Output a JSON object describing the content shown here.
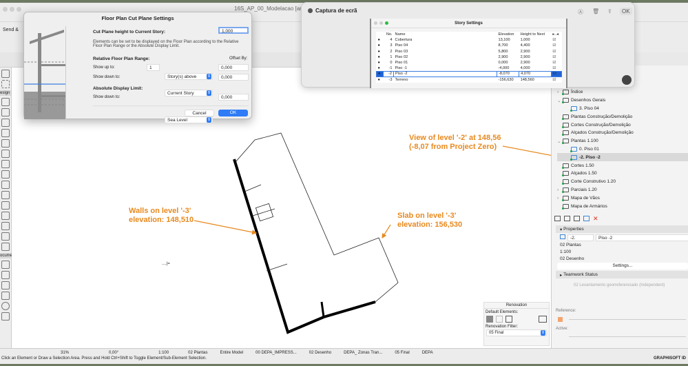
{
  "window": {
    "title": "16S_AP_00_Modelacao [an"
  },
  "toolbar": {
    "send_label": "Send &"
  },
  "toolbox": {
    "design_label": "esign",
    "document_label": "ocume"
  },
  "cut_plane_dialog": {
    "title": "Floor Plan Cut Plane Settings",
    "cut_plane_label": "Cut Plane height to Current Story:",
    "cut_plane_value": "1,000",
    "description": "Elements can be set to be displayed on the Floor Plan according to the Relative Floor Plan Range or the Absolute Display Limit.",
    "relative_range_label": "Relative Floor Plan Range:",
    "offset_by_label": "Offset By:",
    "show_up_to_label": "Show up to:",
    "show_up_to_count": "1",
    "show_up_to_select": "Story(s) above",
    "show_up_to_offset": "0,000",
    "show_down_to_label": "Show down to:",
    "show_down_to_select": "Current Story",
    "show_down_to_offset": "0,000",
    "absolute_limit_label": "Absolute Display Limit:",
    "abs_show_down_to_label": "Show down to:",
    "abs_select": "Sea Level",
    "abs_offset": "0,000",
    "cancel": "Cancel",
    "ok": "OK"
  },
  "capture": {
    "title": "Captura de ecrã",
    "ok": "OK"
  },
  "story_settings": {
    "title": "Story Settings",
    "columns": [
      "No.",
      "Name",
      "Elevation",
      "Height to Next",
      "▸..◂"
    ],
    "rows": [
      {
        "no": "4",
        "name": "Cobertura",
        "elevation": "13,100",
        "height": "1,000"
      },
      {
        "no": "3",
        "name": "Piso 04",
        "elevation": "8,700",
        "height": "4,400"
      },
      {
        "no": "2",
        "name": "Piso 03",
        "elevation": "5,800",
        "height": "2,900"
      },
      {
        "no": "1",
        "name": "Piso 02",
        "elevation": "2,900",
        "height": "2,900"
      },
      {
        "no": "0",
        "name": "Piso 01",
        "elevation": "0,000",
        "height": "2,900"
      },
      {
        "no": "-1",
        "name": "Piso -1",
        "elevation": "-4,000",
        "height": "4,000"
      },
      {
        "no": "-2",
        "name": "Piso -2",
        "elevation": "-8,070",
        "height": "4,070",
        "selected": true
      },
      {
        "no": "-3",
        "name": "Terreno",
        "elevation": "-156,630",
        "height": "148,560"
      }
    ]
  },
  "annotations": {
    "walls": [
      "Walls on level '-3'",
      "elevation: 148,510"
    ],
    "slab": [
      "Slab on level '-3'",
      "elevation: 156,530"
    ],
    "view": [
      "View of level '-2' at 148,56",
      "(-8,07 from Project Zero)"
    ]
  },
  "canvas": {
    "marker": "....|="
  },
  "navigator": {
    "items": [
      {
        "label": "Índice",
        "type": "folder",
        "expand": ">"
      },
      {
        "label": "Desenhos Gerais",
        "type": "folder",
        "expand": "v"
      },
      {
        "label": "3. Piso 04",
        "type": "view",
        "indent": true
      },
      {
        "label": "Plantas Construção/Demolição",
        "type": "folder"
      },
      {
        "label": "Cortes Construção/Demolição",
        "type": "folder"
      },
      {
        "label": "Alçados Construção/Demolição",
        "type": "folder"
      },
      {
        "label": "Plantas 1.100",
        "type": "folder",
        "expand": "v"
      },
      {
        "label": "0. Piso 01",
        "type": "view",
        "indent": true
      },
      {
        "label": "-2. Piso -2",
        "type": "view",
        "indent": true,
        "selected": true
      },
      {
        "label": "Cortes 1.50",
        "type": "folder"
      },
      {
        "label": "Alçados 1.50",
        "type": "folder"
      },
      {
        "label": "Corte Construtivo 1.20",
        "type": "folder"
      },
      {
        "label": "Parciais 1.20",
        "type": "folder",
        "expand": ">"
      },
      {
        "label": "Mapa de Vãos",
        "type": "folder",
        "expand": ">"
      },
      {
        "label": "Mapa de Armários",
        "type": "folder"
      }
    ]
  },
  "properties": {
    "title": "Properties",
    "id": "-2.",
    "name": "Piso -2",
    "layer_combo": "02 Plantas",
    "scale": "1:100",
    "pen_set": "02 Desenho",
    "settings": "Settings...",
    "teamwork": "Teamwork Status",
    "source": "02 Levantamento georreferenciado (Independent)",
    "reference": "Reference:",
    "active": "Active:"
  },
  "renovation": {
    "title": "Renovation",
    "default_elements": "Default Elements:",
    "filter_label": "Renovation Filter:",
    "filter_value": "05 Final"
  },
  "statusbar": {
    "items": [
      "31%",
      "0,00°",
      "1:100",
      "02 Plantas",
      "Entire Model",
      "00 DEPA_IMPRESS...",
      "02 Desenho",
      "DEPA_ Zonas Tran...",
      "05 Final",
      "DEPA"
    ],
    "hint": "Click an Element or Draw a Selection Area. Press and Hold Ctrl+Shift to Toggle Element/Sub-Element Selection.",
    "brand": "GRAPHISOFT ID"
  },
  "colors": {
    "annotation": "#e8891e",
    "accent": "#2f7cf6"
  }
}
